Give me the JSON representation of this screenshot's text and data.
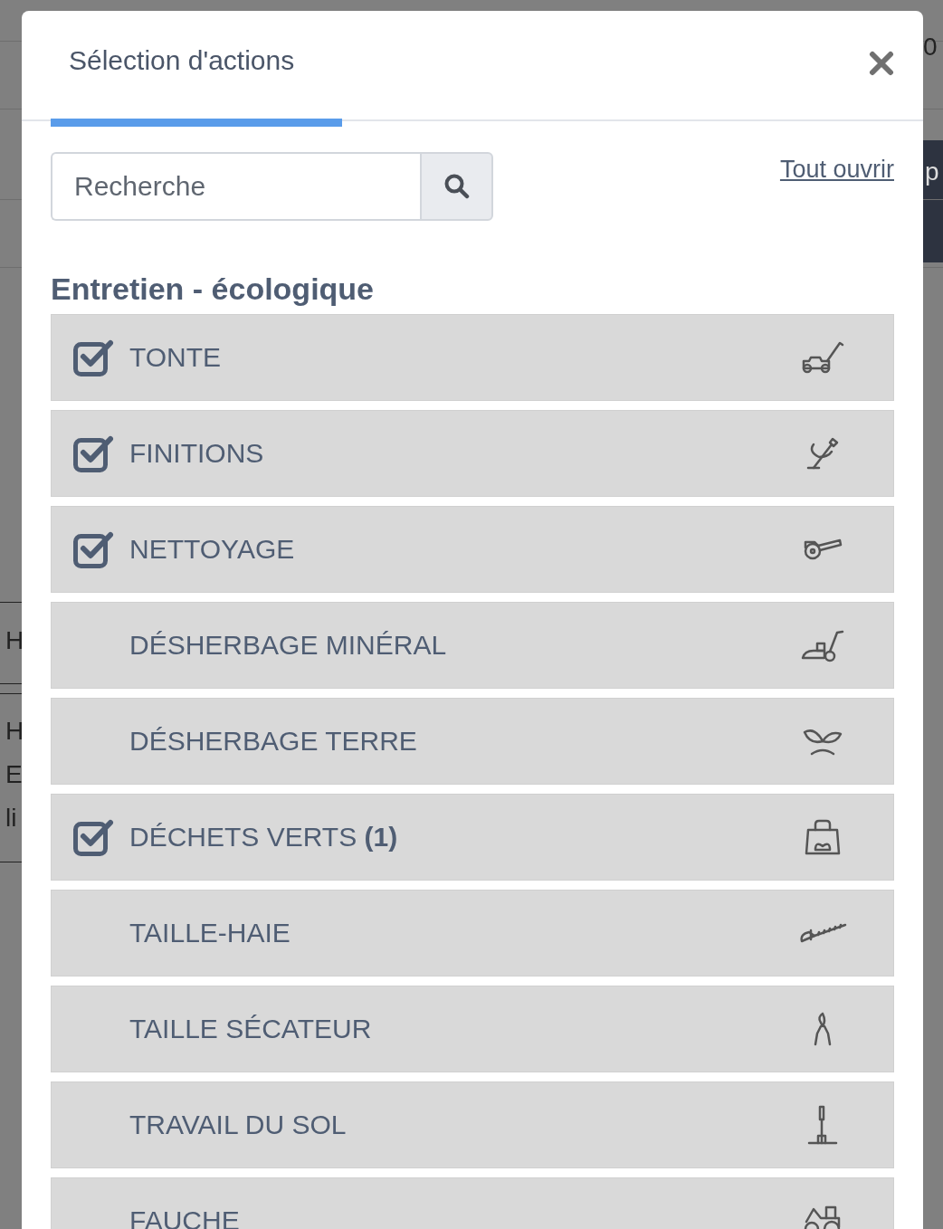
{
  "backdrop": {
    "texts": [
      "0",
      "p",
      "H",
      "H",
      "E",
      "li"
    ]
  },
  "modal": {
    "tabs": [
      {
        "label": "Sélection d'actions",
        "selected": true
      }
    ],
    "search": {
      "placeholder": "Recherche"
    },
    "open_all": "Tout ouvrir",
    "section": "Entretien - écologique",
    "actions": [
      {
        "label": "TONTE",
        "checked": true
      },
      {
        "label": "FINITIONS",
        "checked": true
      },
      {
        "label": "NETTOYAGE",
        "checked": true
      },
      {
        "label": "DÉSHERBAGE MINÉRAL",
        "checked": false
      },
      {
        "label": "DÉSHERBAGE TERRE",
        "checked": false
      },
      {
        "label": "DÉCHETS VERTS **(1)**",
        "checked": true
      },
      {
        "label": "TAILLE-HAIE",
        "checked": false
      },
      {
        "label": "TAILLE SÉCATEUR",
        "checked": false
      },
      {
        "label": "TRAVAIL DU SOL",
        "checked": false
      },
      {
        "label": "FAUCHE",
        "checked": false
      }
    ]
  }
}
